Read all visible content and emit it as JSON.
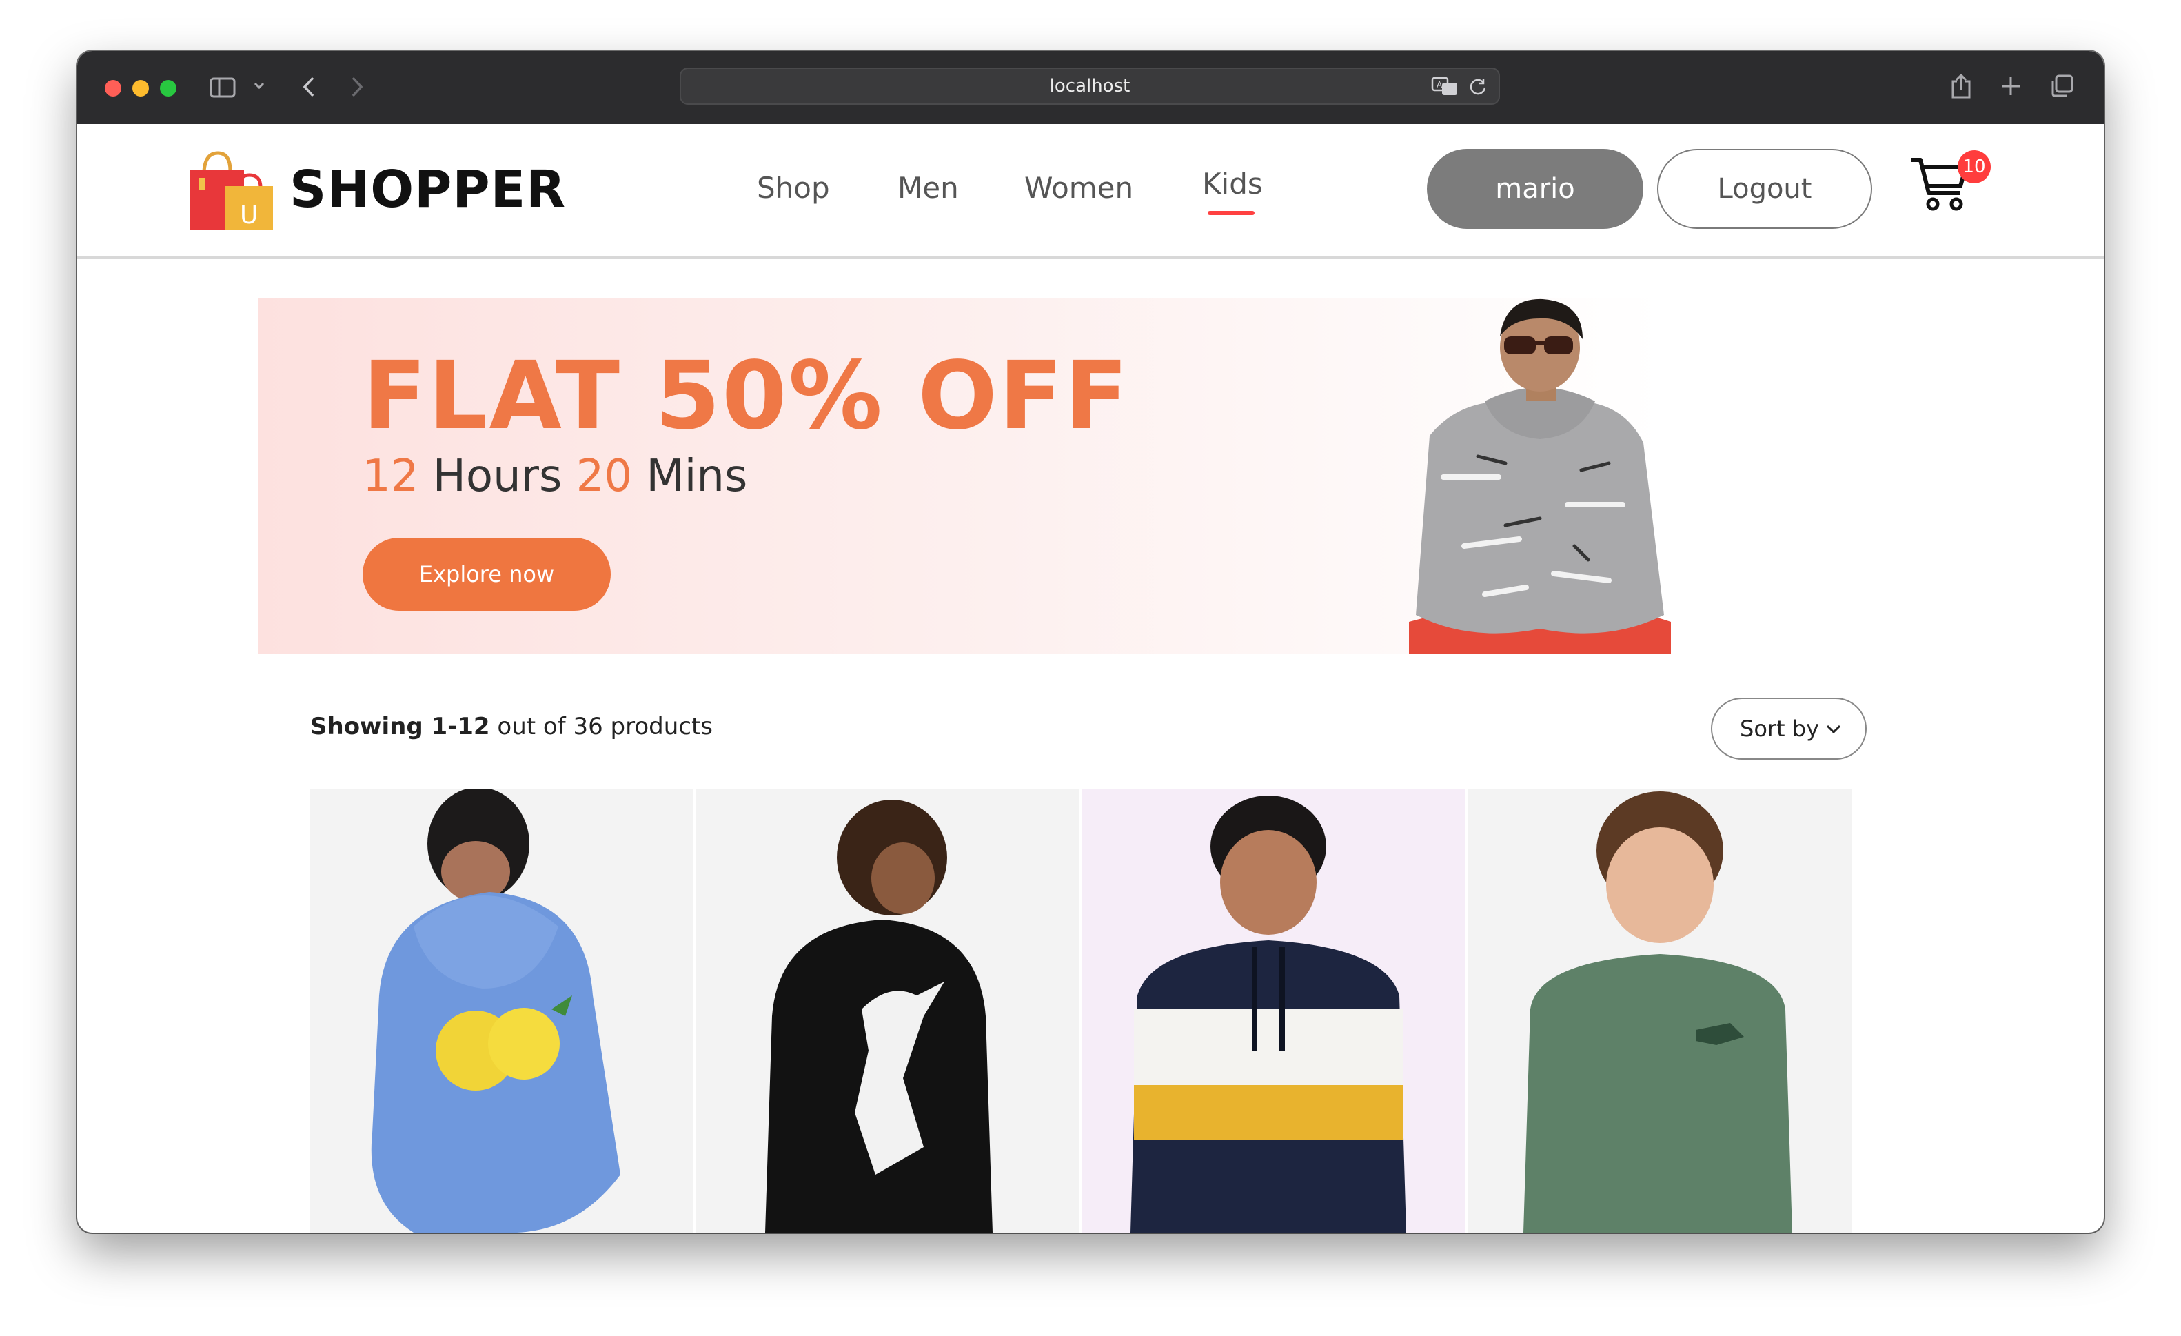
{
  "browser": {
    "url": "localhost",
    "icons": [
      "sidebar-icon",
      "chevron-down-icon",
      "back-icon",
      "forward-icon",
      "translate-icon",
      "reload-icon",
      "share-icon",
      "new-tab-icon",
      "tabs-overview-icon"
    ]
  },
  "nav": {
    "logo_text": "SHOPPER",
    "menu": [
      {
        "label": "Shop",
        "active": false
      },
      {
        "label": "Men",
        "active": false
      },
      {
        "label": "Women",
        "active": false
      },
      {
        "label": "Kids",
        "active": true
      }
    ],
    "user_label": "mario",
    "logout_label": "Logout",
    "cart_count": "10",
    "accent": "#ff4141"
  },
  "hero": {
    "title": "FLAT 50% OFF",
    "hours": "12",
    "hours_label": "Hours",
    "mins": "20",
    "mins_label": "Mins",
    "button": "Explore now",
    "accent": "#ef7846"
  },
  "results": {
    "showing_label": "Showing 1-12",
    "rest": "out of 36 products"
  },
  "sort": {
    "label": "Sort by"
  },
  "products": [
    {
      "description": "Blue lemon-print hoodie",
      "bg": "#f3f3f3",
      "color": "#6f98dd"
    },
    {
      "description": "Black football-print hoodie",
      "bg": "#f3f3f3",
      "color": "#121212"
    },
    {
      "description": "Colour-block hoodie",
      "bg": "#f6edf8",
      "color": "#1d2540"
    },
    {
      "description": "Green dinosaur sweatshirt",
      "bg": "#f3f3f3",
      "color": "#5e8168"
    }
  ]
}
